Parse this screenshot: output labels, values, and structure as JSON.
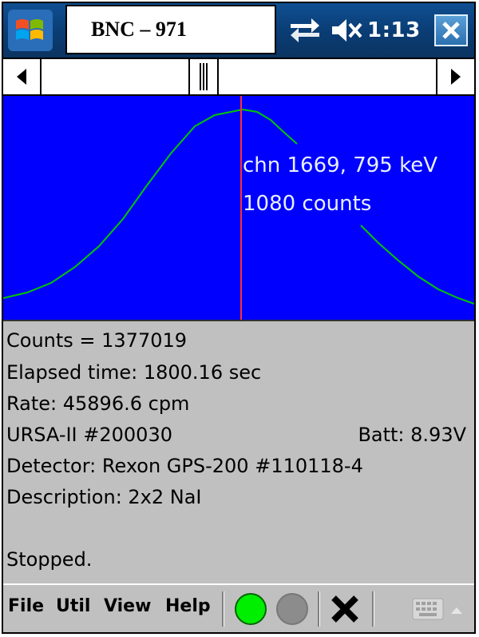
{
  "window": {
    "title": "BNC – 971"
  },
  "status": {
    "time": "1:13"
  },
  "colors": {
    "plot_bg": "#0000ff",
    "trace": "#00c800",
    "cursor": "#ff3030",
    "go": "#00ee00"
  },
  "icons": {
    "start": "windows-start-icon",
    "connectivity": "connectivity-arrows-icon",
    "volume": "speaker-muted-icon",
    "close": "close-x-icon"
  },
  "plot": {
    "cursor_line1": "chn 1669, 795 keV",
    "cursor_line2": "1080 counts"
  },
  "info": {
    "counts": "Counts = 1377019",
    "elapsed": "Elapsed time: 1800.16 sec",
    "rate": "Rate: 45896.6 cpm",
    "device": "URSA-II #200030",
    "battery": "Batt: 8.93V",
    "detector": "Detector: Rexon GPS-200 #110118-4",
    "description": "Description: 2x2 NaI",
    "state": "Stopped."
  },
  "menu": {
    "file": "File",
    "util": "Util",
    "view": "View",
    "help": "Help"
  },
  "toolbar": {
    "start_icon": "green-circle-icon",
    "stop_icon": "gray-circle-icon",
    "clear_icon": "black-x-icon",
    "keyboard_icon": "keyboard-icon"
  }
}
